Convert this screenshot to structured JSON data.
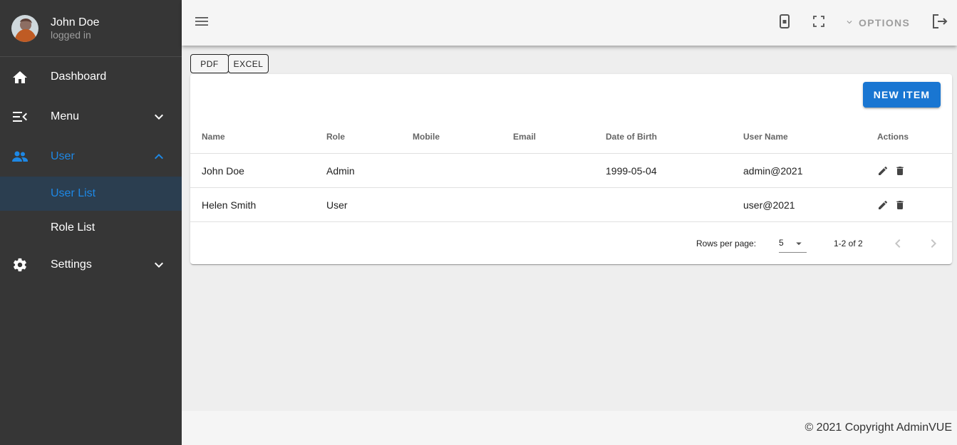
{
  "sidebar": {
    "profile": {
      "name": "John Doe",
      "status": "logged in"
    },
    "items": [
      {
        "label": "Dashboard",
        "icon": "home-icon"
      },
      {
        "label": "Menu",
        "icon": "menu-open-icon"
      },
      {
        "label": "User",
        "icon": "account-group-icon"
      },
      {
        "label": "Settings",
        "icon": "gear-icon"
      }
    ],
    "sub_items": [
      {
        "label": "User List"
      },
      {
        "label": "Role List"
      }
    ]
  },
  "topbar": {
    "options_label": "OPTIONS"
  },
  "export": {
    "pdf_label": "PDF",
    "excel_label": "EXCEL"
  },
  "table": {
    "new_item_label": "NEW ITEM",
    "headers": [
      "Name",
      "Role",
      "Mobile",
      "Email",
      "Date of Birth",
      "User Name",
      "Actions"
    ],
    "rows": [
      {
        "name": "John Doe",
        "role": "Admin",
        "mobile": "",
        "email": "",
        "dob": "1999-05-04",
        "username": "admin@2021"
      },
      {
        "name": "Helen Smith",
        "role": "User",
        "mobile": "",
        "email": "",
        "dob": "",
        "username": "user@2021"
      }
    ],
    "rows_per_page_label": "Rows per page:",
    "rows_per_page_value": "5",
    "range_text": "1-2 of 2"
  },
  "footer": {
    "copyright": "© 2021 Copyright AdminVUE"
  },
  "colors": {
    "accent": "#1976d2",
    "active": "#1e88e5",
    "sidebar_bg": "#363636",
    "selected_bg": "#2b3e50"
  }
}
